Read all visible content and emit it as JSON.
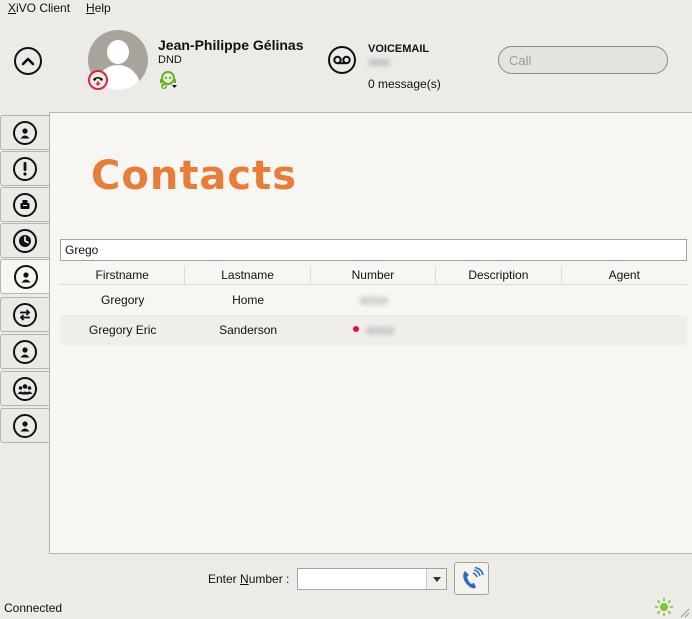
{
  "menu": {
    "items": [
      {
        "label": "XiVO Client",
        "mnemonic_first": "X",
        "rest": "iVO Client"
      },
      {
        "label": "Help",
        "mnemonic_first": "H",
        "rest": "elp"
      }
    ]
  },
  "identity": {
    "name": "Jean-Philippe Gélinas",
    "status": "DND",
    "presence_color": "#d42a3a",
    "agent_status_color": "#6ab023"
  },
  "voicemail": {
    "title": "VOICEMAIL",
    "number": "4896",
    "messages": "0 message(s)"
  },
  "call": {
    "placeholder": "Call"
  },
  "sidebar": {
    "tabs": [
      {
        "icon": "person-icon"
      },
      {
        "icon": "exclamation-icon"
      },
      {
        "icon": "fax-icon"
      },
      {
        "icon": "clock-icon"
      },
      {
        "icon": "contact-icon",
        "active": true
      },
      {
        "icon": "transfer-icon"
      },
      {
        "icon": "person-icon"
      },
      {
        "icon": "group-icon"
      },
      {
        "icon": "person-icon"
      }
    ]
  },
  "contacts": {
    "title": "Contacts",
    "title_color": "#e67e3a",
    "search_value": "Grego",
    "columns": [
      "Firstname",
      "Lastname",
      "Number",
      "Description",
      "Agent"
    ],
    "rows": [
      {
        "firstname": "Gregory",
        "lastname": "Home",
        "number": "42316",
        "description": "",
        "agent": "",
        "status_dot": false
      },
      {
        "firstname": "Gregory Eric",
        "lastname": "Sanderson",
        "number": "42315",
        "description": "",
        "agent": "",
        "status_dot": true,
        "status_color": "#e8103a"
      }
    ]
  },
  "dial": {
    "label_before": "Enter ",
    "label_mnemonic": "N",
    "label_after": "umber :",
    "value": ""
  },
  "status": {
    "text": "Connected"
  }
}
